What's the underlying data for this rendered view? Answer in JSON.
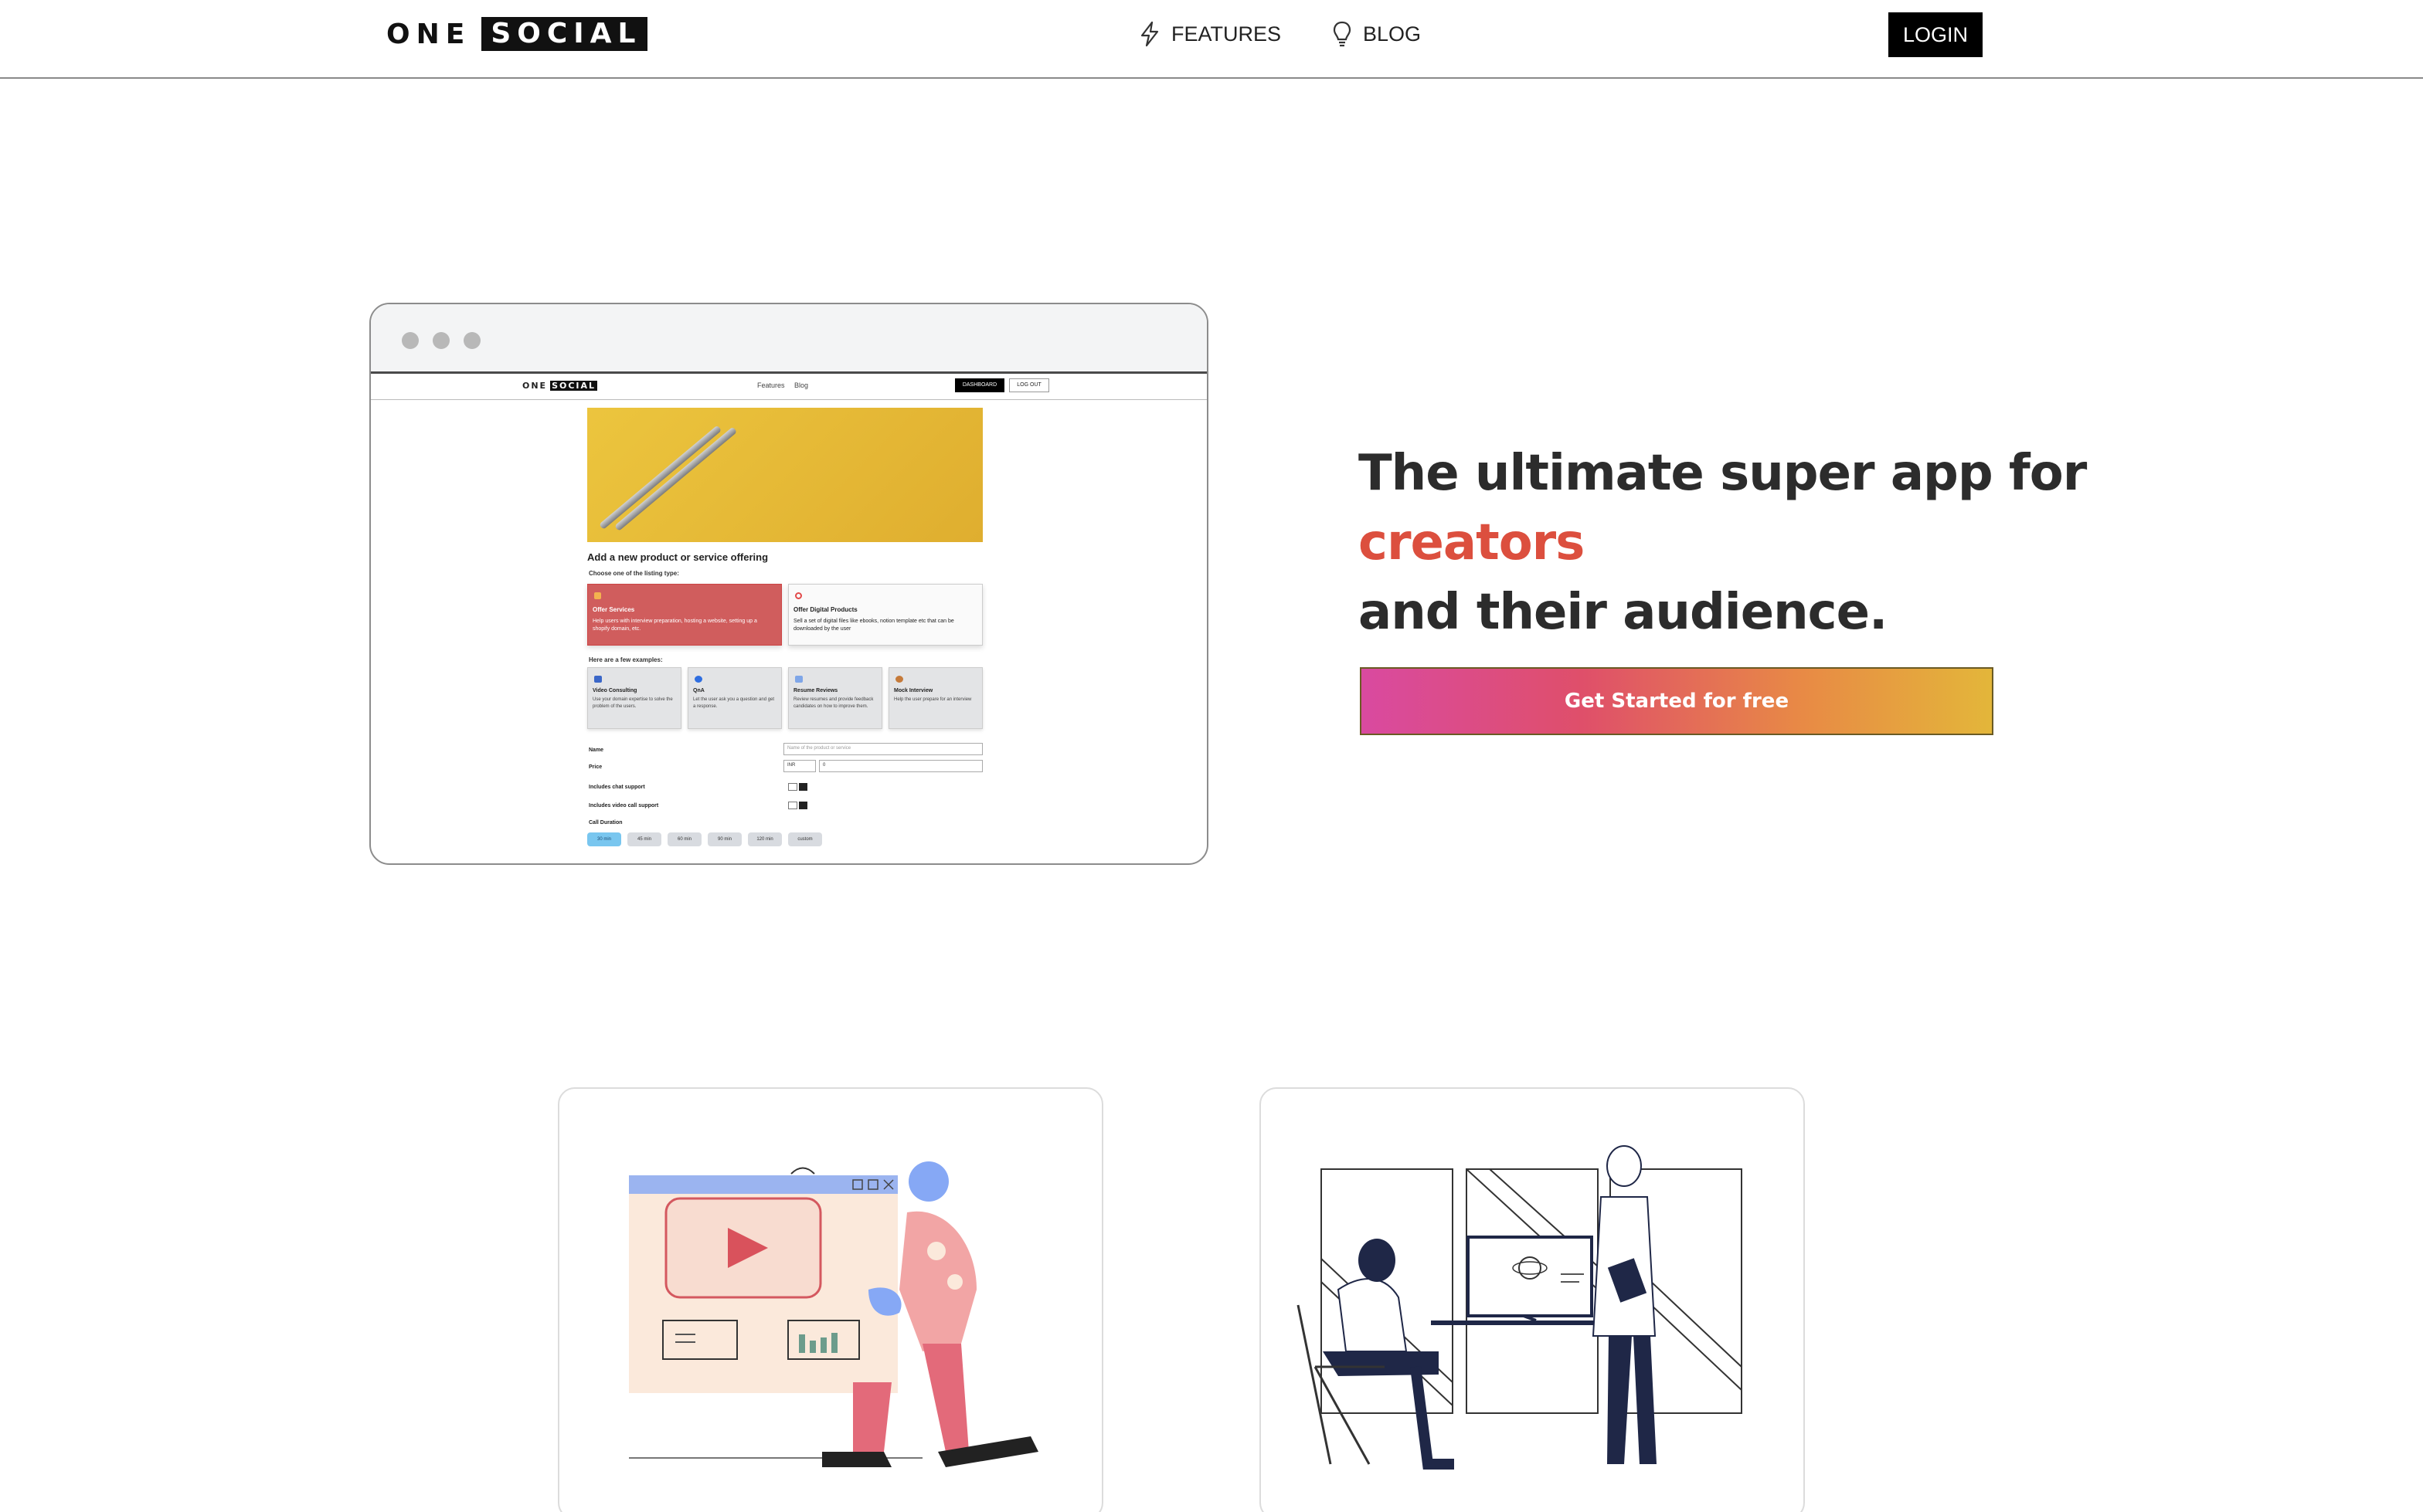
{
  "nav": {
    "logo_one": "ONE",
    "logo_social": "SOCIAL",
    "features_label": "FEATURES",
    "blog_label": "BLOG",
    "login_label": "LOGIN"
  },
  "mockup": {
    "logo_one": "ONE",
    "logo_social": "SOCIAL",
    "features_label": "Features",
    "blog_label": "Blog",
    "dashboard_label": "DASHBOARD",
    "logout_label": "LOG OUT",
    "heading": "Add a new product or service offering",
    "choose_label": "Choose one of the listing type:",
    "offer_services_title": "Offer Services",
    "offer_services_desc": "Help users with interview preparation, hosting a website, setting up a shopify domain, etc.",
    "offer_digital_title": "Offer Digital Products",
    "offer_digital_desc": "Sell a set of digital files like ebooks, notion template etc that can be downloaded by the user",
    "examples_label": "Here are a few examples:",
    "examples": [
      {
        "title": "Video Consulting",
        "desc": "Use your domain expertise to solve the problem of the users."
      },
      {
        "title": "QnA",
        "desc": "Let the user ask you a question and get a response."
      },
      {
        "title": "Resume Reviews",
        "desc": "Review resumes and provide feedback candidates on how to improve them."
      },
      {
        "title": "Mock Interview",
        "desc": "Help the user prepare for an interview"
      }
    ],
    "name_label": "Name",
    "name_placeholder": "Name of the product or service",
    "price_label": "Price",
    "currency_value": "INR",
    "price_value": "0",
    "chat_label": "Includes chat support",
    "video_label": "Includes video call support",
    "duration_label": "Call Duration",
    "durations": [
      "30 min",
      "45 min",
      "60 min",
      "90 min",
      "120 min",
      "custom"
    ]
  },
  "hero": {
    "line1": "The ultimate super app for",
    "line2": "creators",
    "line3": "and their audience.",
    "cta_label": "Get Started for free",
    "accent_color": "#dc4f3e"
  },
  "icons": [
    "bolt-icon",
    "lightbulb-icon"
  ]
}
